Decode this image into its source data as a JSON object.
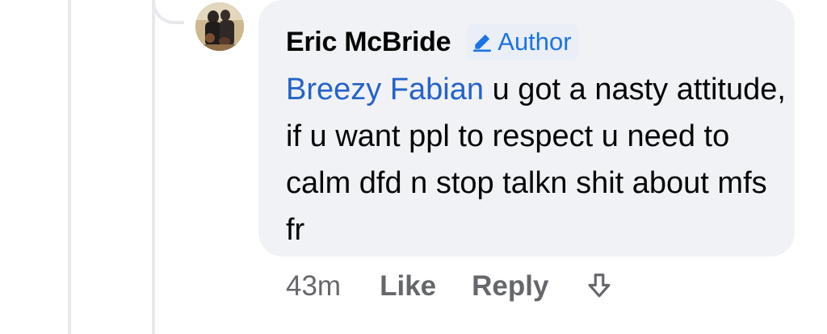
{
  "comment": {
    "author": "Eric McBride",
    "badge_label": "Author",
    "badge_icon": "pencil-icon",
    "mention": "Breezy Fabian",
    "text": " u got a nasty attitude, if u want ppl to respect u need to calm dfd n stop talkn shit about mfs fr"
  },
  "actions": {
    "time": "43m",
    "like": "Like",
    "reply": "Reply",
    "share_icon": "share-arrow-icon"
  },
  "colors": {
    "bubble": "#f0f2f5",
    "accent": "#1b74e4",
    "mention": "#2563c9",
    "muted": "#65676b"
  }
}
